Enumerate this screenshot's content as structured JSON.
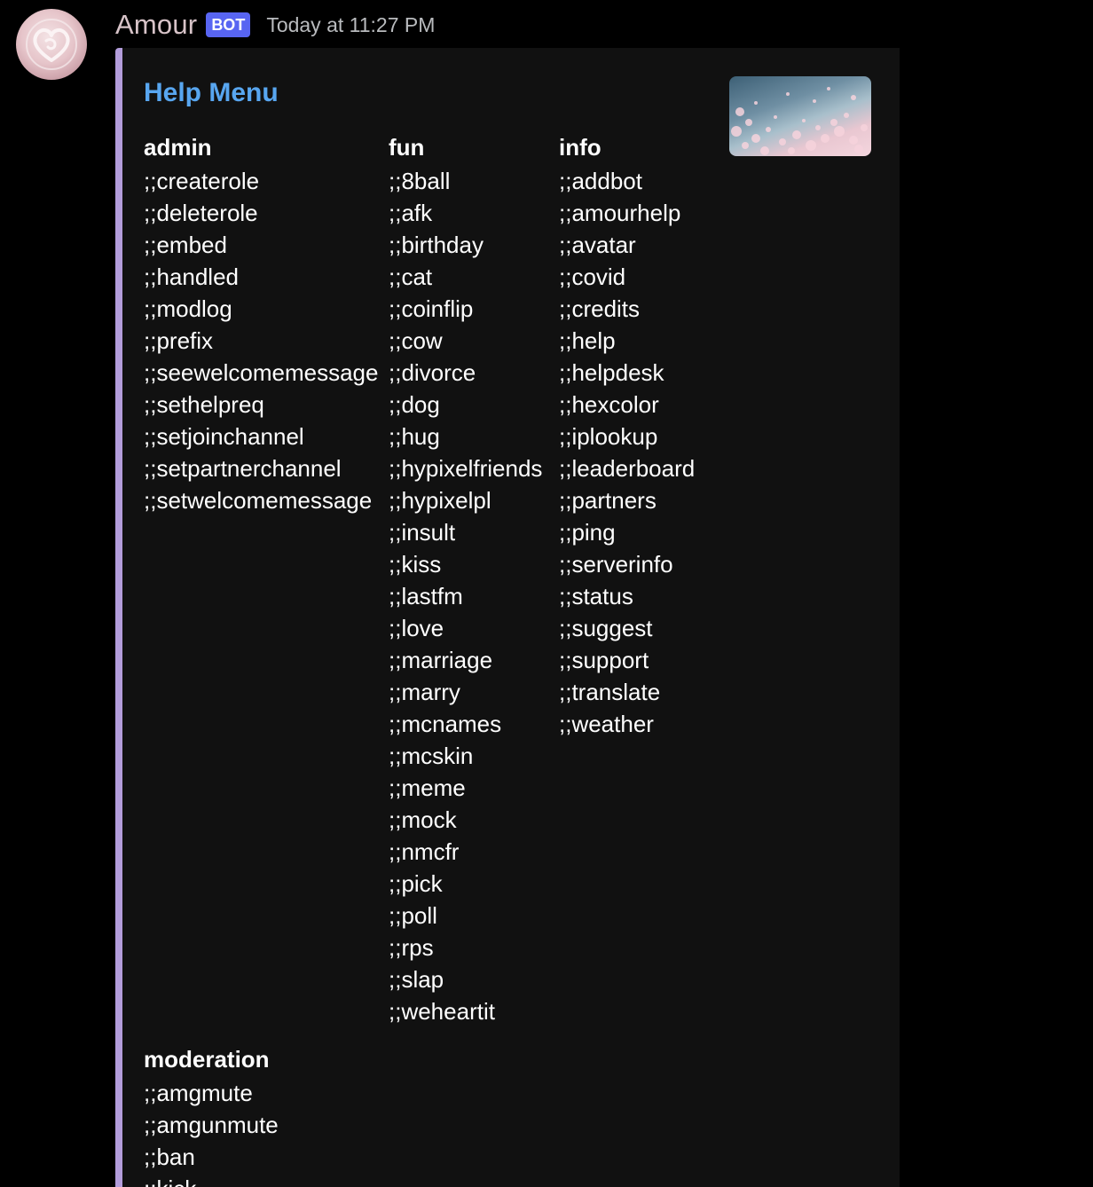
{
  "message": {
    "username": "Amour",
    "tag": "BOT",
    "timestamp": "Today at 11:27 PM",
    "colors": {
      "embed_border": "#b39ddb",
      "title": "#58a6f0",
      "bot_tag": "#5865f2",
      "embed_bg": "#111111",
      "page_bg": "#000000"
    }
  },
  "embed": {
    "title": "Help Menu",
    "fields": {
      "admin": {
        "name": "admin",
        "commands": [
          ";;createrole",
          ";;deleterole",
          ";;embed",
          ";;handled",
          ";;modlog",
          ";;prefix",
          ";;seewelcomemessage",
          ";;sethelpreq",
          ";;setjoinchannel",
          ";;setpartnerchannel",
          ";;setwelcomemessage"
        ]
      },
      "fun": {
        "name": "fun",
        "commands": [
          ";;8ball",
          ";;afk",
          ";;birthday",
          ";;cat",
          ";;coinflip",
          ";;cow",
          ";;divorce",
          ";;dog",
          ";;hug",
          ";;hypixelfriends",
          ";;hypixelpl",
          ";;insult",
          ";;kiss",
          ";;lastfm",
          ";;love",
          ";;marriage",
          ";;marry",
          ";;mcnames",
          ";;mcskin",
          ";;meme",
          ";;mock",
          ";;nmcfr",
          ";;pick",
          ";;poll",
          ";;rps",
          ";;slap",
          ";;weheartit"
        ]
      },
      "info": {
        "name": "info",
        "commands": [
          ";;addbot",
          ";;amourhelp",
          ";;avatar",
          ";;covid",
          ";;credits",
          ";;help",
          ";;helpdesk",
          ";;hexcolor",
          ";;iplookup",
          ";;leaderboard",
          ";;partners",
          ";;ping",
          ";;serverinfo",
          ";;status",
          ";;suggest",
          ";;support",
          ";;translate",
          ";;weather"
        ]
      },
      "moderation": {
        "name": "moderation",
        "commands": [
          ";;amgmute",
          ";;amgunmute",
          ";;ban",
          ";;kick"
        ]
      }
    }
  },
  "icons": {
    "avatar": "heart-logo-avatar",
    "thumbnail": "cherry-blossom-thumbnail"
  }
}
